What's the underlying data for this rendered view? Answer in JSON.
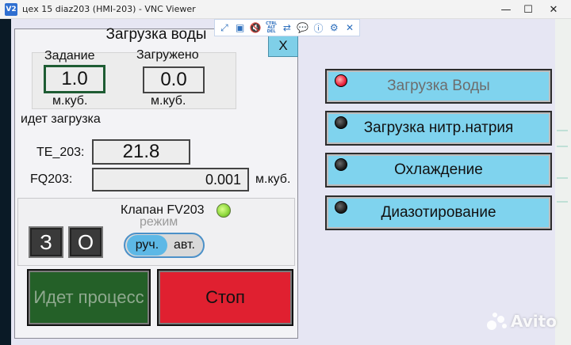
{
  "window": {
    "app_icon_text": "V2",
    "title": "цех 15 diaz203 (HMI-203) - VNC Viewer",
    "minimize_glyph": "—",
    "maximize_glyph": "☐",
    "close_glyph": "✕"
  },
  "vnc_toolbar": {
    "icons": [
      "expand-icon",
      "scale-icon",
      "mute-icon",
      "ctrl-alt-del-icon",
      "transfer-icon",
      "chat-icon",
      "info-icon",
      "settings-icon",
      "close-icon"
    ],
    "ctrl_alt_del_text": "CTRL ALT DEL"
  },
  "panel": {
    "title": "Загрузка воды",
    "close_label": "X",
    "setpoint_label": "Задание",
    "setpoint_value": "1.0",
    "setpoint_unit": "м.куб.",
    "loaded_label": "Загружено",
    "loaded_value": "0.0",
    "loaded_unit": "м.куб.",
    "status_text": "идет загрузка",
    "te_label": "TE_203:",
    "te_value": "21.8",
    "fq_label": "FQ203:",
    "fq_value": "0.001",
    "fq_unit": "м.куб.",
    "valve_label": "Клапан FV203",
    "valve_lamp_color": "#8bd63a",
    "close_valve_label": "З",
    "open_valve_label": "О",
    "mode_label": "режим",
    "mode_manual": "руч.",
    "mode_auto": "авт.",
    "process_button": "Идет процесс",
    "stop_button": "Стоп"
  },
  "stages": [
    {
      "label": "Загрузка Воды",
      "active": true
    },
    {
      "label": "Загрузка нитр.натрия",
      "active": false
    },
    {
      "label": "Охлаждение",
      "active": false
    },
    {
      "label": "Диазотирование",
      "active": false
    }
  ],
  "colors": {
    "stage_button": "#7fd3ee",
    "stop_button": "#e02030",
    "process_button": "#246028",
    "active_led": "#e8213a"
  },
  "watermark": {
    "text": "Avito"
  }
}
